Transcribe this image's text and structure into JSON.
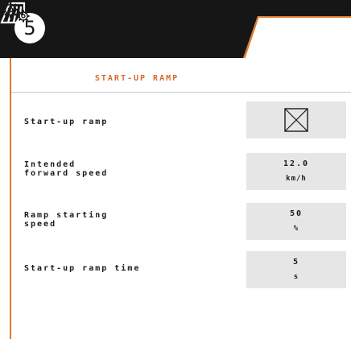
{
  "header": {
    "step_number": "5",
    "machine_icon": "drill-machine-icon",
    "settings_icon": "gears-settings-icon",
    "colors": {
      "bar": "#161616",
      "accent": "#e07a2c"
    }
  },
  "page": {
    "title": "START-UP RAMP"
  },
  "rows": [
    {
      "label": "Start-up ramp",
      "type": "checkbox",
      "checked": true
    },
    {
      "label": "Intended\nforward speed",
      "value": "12.0",
      "unit": "km/h"
    },
    {
      "label": "Ramp starting\nspeed",
      "value": "50",
      "unit": "%"
    },
    {
      "label": "Start-up ramp time",
      "value": "5",
      "unit": "s"
    }
  ]
}
